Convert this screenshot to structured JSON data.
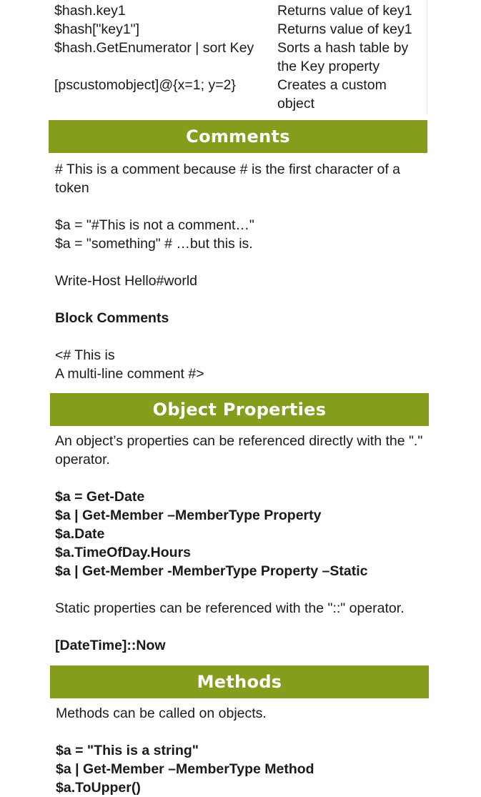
{
  "hash_rows": [
    {
      "cmd": "$hash.key1",
      "desc": "Returns value of key1"
    },
    {
      "cmd": "$hash[\"key1\"]",
      "desc": "Returns value of key1"
    },
    {
      "cmd": "$hash.GetEnumerator | sort Key",
      "desc": "Sorts a hash table by the Key property"
    },
    {
      "cmd": "[pscustomobject]@{x=1; y=2}",
      "desc": "Creates a custom object"
    }
  ],
  "comments": {
    "title": "Comments",
    "line1": "# This is a comment because # is the first character of a token",
    "line2": "$a = \"#This is not a comment…\"",
    "line3": "$a = \"something\" # …but this is.",
    "line4": "Write-Host Hello#world",
    "block_heading": "Block Comments",
    "block_line1": "<# This is",
    "block_line2": "A multi-line comment #>"
  },
  "object_properties": {
    "title": "Object Properties",
    "intro": "An object’s properties can be referenced directly with the \".\" operator.",
    "code": [
      "$a = Get-Date",
      "$a | Get-Member –MemberType Property",
      "$a.Date",
      "$a.TimeOfDay.Hours",
      "$a | Get-Member -MemberType Property –Static"
    ],
    "static_note": "Static properties can be referenced with the \"::\" operator.",
    "static_code": "[DateTime]::Now"
  },
  "methods": {
    "title": "Methods",
    "intro": "Methods can be called on objects.",
    "code": [
      "$a = \"This is a string\"",
      "$a | Get-Member –MemberType Method",
      "$a.ToUpper()"
    ]
  }
}
